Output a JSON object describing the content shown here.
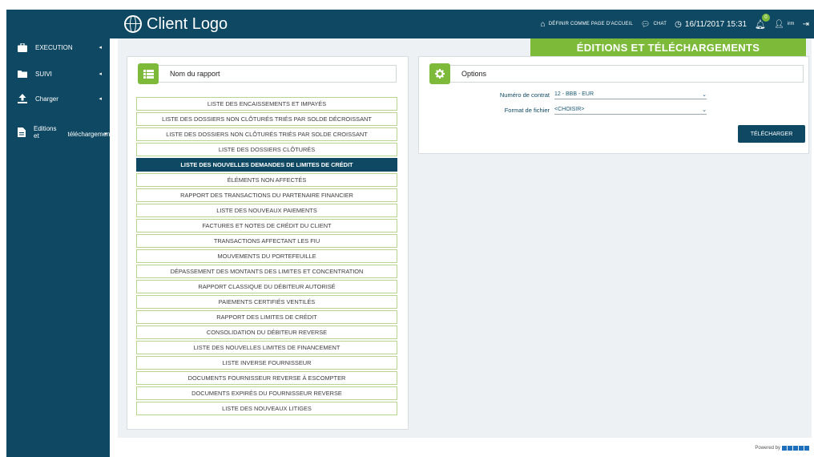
{
  "header": {
    "logo_text": "Client Logo",
    "home_link": "DÉFINIR COMME PAGE D'ACCUEIL",
    "chat_label": "CHAT",
    "datetime": "16/11/2017 15:31",
    "notification_count": "0",
    "user_name": "irm"
  },
  "user": {
    "initial": "!"
  },
  "sidebar": {
    "items": [
      {
        "label": "EXECUTION"
      },
      {
        "label": "SUIVI"
      },
      {
        "label": "Charger"
      },
      {
        "label_line1": "Editions et",
        "label_line2": "téléchargements"
      }
    ]
  },
  "banner": {
    "title": "ÉDITIONS ET TÉLÉCHARGEMENTS"
  },
  "report_panel": {
    "title": "Nom du rapport",
    "items": [
      "LISTE DES ENCAISSEMENTS ET IMPAYÉS",
      "LISTE DES DOSSIERS NON CLÔTURÉS TRIÉS PAR SOLDE DÉCROISSANT",
      "LISTE DES DOSSIERS NON CLÔTURÉS TRIÉS PAR SOLDE CROISSANT",
      "LISTE DES DOSSIERS CLÔTURÉS",
      "LISTE DES NOUVELLES DEMANDES DE LIMITES DE CRÉDIT",
      "ÉLÉMENTS NON AFFECTÉS",
      "RAPPORT DES TRANSACTIONS DU PARTENAIRE FINANCIER",
      "LISTE DES NOUVEAUX PAIEMENTS",
      "FACTURES ET NOTES DE CRÉDIT DU CLIENT",
      "TRANSACTIONS AFFECTANT LES FIU",
      "MOUVEMENTS DU PORTEFEUILLE",
      "DÉPASSEMENT DES MONTANTS DES LIMITES ET CONCENTRATION",
      "RAPPORT CLASSIQUE DU DÉBITEUR AUTORISÉ",
      "PAIEMENTS CERTIFIÉS VENTILÉS",
      "RAPPORT DES LIMITES DE CRÉDIT",
      "CONSOLIDATION DU DÉBITEUR REVERSE",
      "LISTE DES NOUVELLES LIMITES DE FINANCEMENT",
      "LISTE INVERSE FOURNISSEUR",
      "DOCUMENTS FOURNISSEUR REVERSE À ESCOMPTER",
      "DOCUMENTS EXPIRÉS DU FOURNISSEUR REVERSE",
      "LISTE DES NOUVEAUX LITIGES"
    ]
  },
  "options_panel": {
    "title": "Options",
    "contract_label": "Numéro de contrat",
    "contract_value": "12 - BBB - EUR",
    "format_label": "Format de fichier",
    "format_value": "<CHOISIR>",
    "download_label": "TÉLÉCHARGER"
  },
  "footer": {
    "text": "Powered by"
  },
  "colors": {
    "navy": "#0e4862",
    "green": "#7dba3a",
    "bg": "#eef1f3"
  }
}
